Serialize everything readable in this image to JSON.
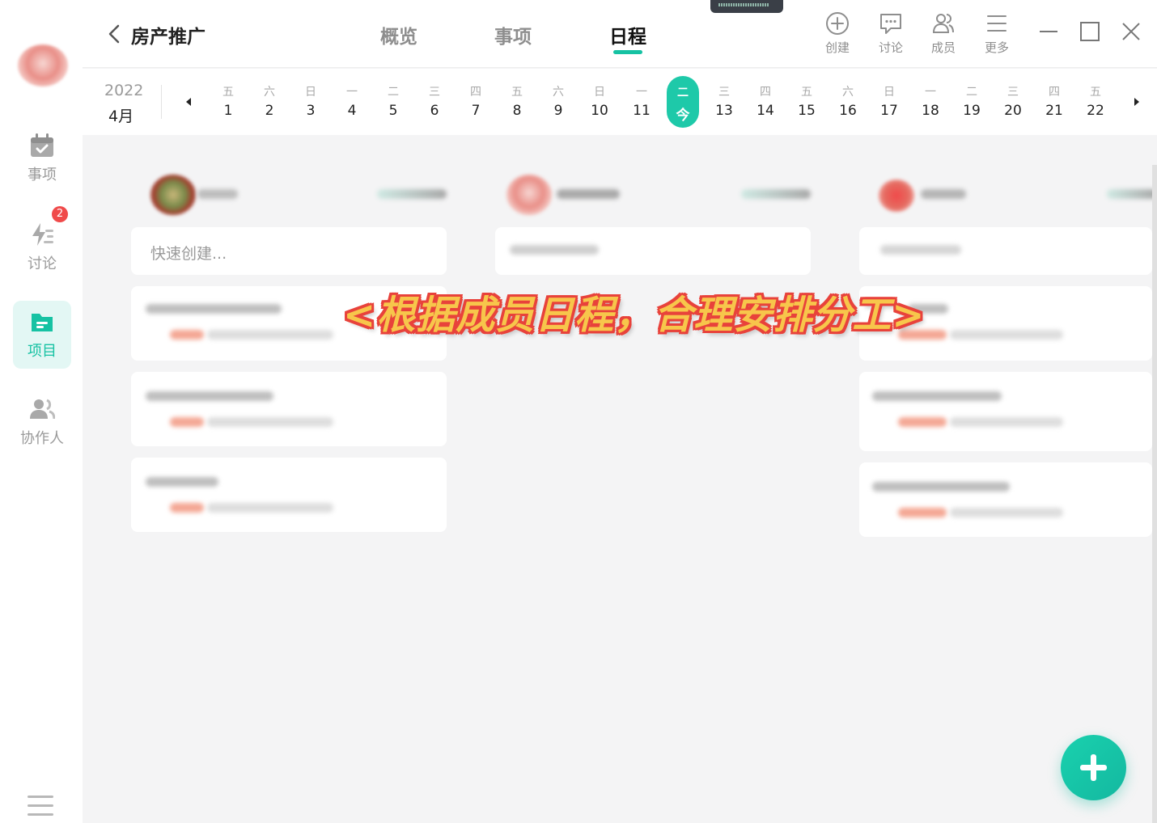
{
  "sidebar": {
    "items": [
      {
        "label": "事项",
        "icon": "calendar-check-icon",
        "active": false
      },
      {
        "label": "讨论",
        "icon": "discussion-bolt-icon",
        "active": false,
        "badge": "2"
      },
      {
        "label": "项目",
        "icon": "folder-icon",
        "active": true
      },
      {
        "label": "协作人",
        "icon": "collaborators-icon",
        "active": false
      }
    ]
  },
  "header": {
    "project_title": "房产推广",
    "tabs": [
      {
        "label": "概览",
        "active": false
      },
      {
        "label": "事项",
        "active": false
      },
      {
        "label": "日程",
        "active": true
      }
    ],
    "tools": [
      {
        "label": "创建",
        "icon": "plus-circle-icon"
      },
      {
        "label": "讨论",
        "icon": "chat-bubble-icon"
      },
      {
        "label": "成员",
        "icon": "members-icon"
      },
      {
        "label": "更多",
        "icon": "menu-icon"
      }
    ]
  },
  "calendar": {
    "year": "2022",
    "month": "4月",
    "days": [
      {
        "wd": "五",
        "d": "1"
      },
      {
        "wd": "六",
        "d": "2"
      },
      {
        "wd": "日",
        "d": "3"
      },
      {
        "wd": "一",
        "d": "4"
      },
      {
        "wd": "二",
        "d": "5"
      },
      {
        "wd": "三",
        "d": "6"
      },
      {
        "wd": "四",
        "d": "7"
      },
      {
        "wd": "五",
        "d": "8"
      },
      {
        "wd": "六",
        "d": "9"
      },
      {
        "wd": "日",
        "d": "10"
      },
      {
        "wd": "一",
        "d": "11"
      },
      {
        "wd": "二",
        "d": "今",
        "today": true
      },
      {
        "wd": "三",
        "d": "13"
      },
      {
        "wd": "四",
        "d": "14"
      },
      {
        "wd": "五",
        "d": "15"
      },
      {
        "wd": "六",
        "d": "16"
      },
      {
        "wd": "日",
        "d": "17"
      },
      {
        "wd": "一",
        "d": "18"
      },
      {
        "wd": "二",
        "d": "19"
      },
      {
        "wd": "三",
        "d": "20"
      },
      {
        "wd": "四",
        "d": "21"
      },
      {
        "wd": "五",
        "d": "22"
      }
    ]
  },
  "board": {
    "quick_create_placeholder": "快速创建...",
    "overlay_caption": "<根据成员日程，合理安排分工>"
  },
  "colors": {
    "accent": "#16c2a3",
    "badge": "#f04a4a",
    "caption_fill": "#f7c64b",
    "caption_stroke": "#e8423b"
  }
}
